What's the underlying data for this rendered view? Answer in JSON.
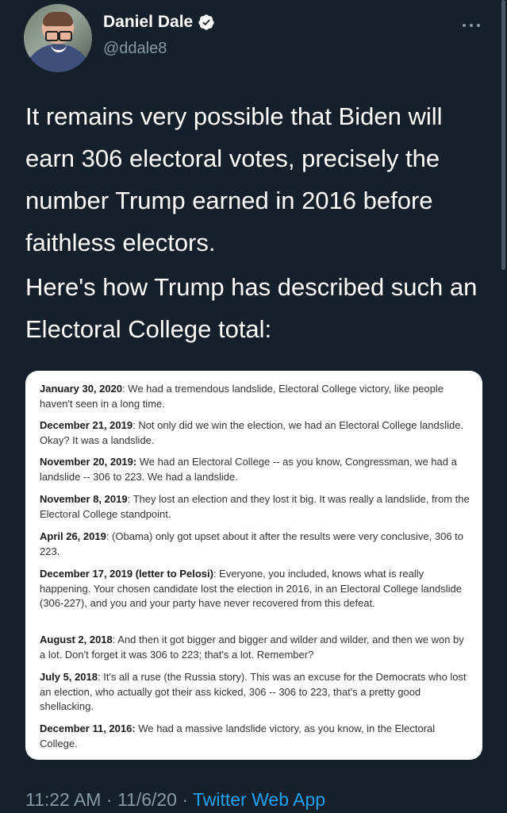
{
  "user": {
    "display_name": "Daniel Dale",
    "handle": "@ddale8",
    "verified": true
  },
  "tweet": {
    "paragraphs": [
      "It remains very possible that Biden will earn 306 electoral votes, precisely the number Trump earned in 2016 before faithless electors.",
      "Here's how Trump has described such an Electoral College total:"
    ],
    "image_entries": [
      {
        "date": "January 30, 2020",
        "text": ":  We had a tremendous landslide, Electoral College victory, like people haven't seen in a long time."
      },
      {
        "date": "December 21, 2019",
        "text": ": Not only did we win the election, we had an Electoral College landslide. Okay? It was a landslide."
      },
      {
        "date": "November 20, 2019:",
        "text": " We had an Electoral College -- as you know, Congressman, we had a landslide -- 306 to 223. We had a landslide."
      },
      {
        "date": "November 8, 2019",
        "text": ": They lost an election and they lost it big. It was really a landslide, from the Electoral College standpoint."
      },
      {
        "date": "April 26, 2019",
        "text": ": (Obama)  only got upset about it after the results were very conclusive, 306 to 223."
      },
      {
        "date": "December 17, 2019 (letter to Pelosi)",
        "text": ": Everyone, you included, knows what is really happening. Your chosen candidate lost the election in 2016, in an Electoral College landslide (306-227), and you and your party have never recovered from this defeat."
      },
      {
        "date": "August 2, 2018",
        "text": ": And then it got bigger and bigger and wilder and wilder, and then we won by a lot. Don't forget it was 306 to 223; that's a lot. Remember?"
      },
      {
        "date": "July 5, 2018",
        "text": ": It's all a ruse (the Russia story). This was an excuse for the Democrats who lost an election, who actually got their ass kicked, 306 -- 306 to 223, that's a pretty good shellacking."
      },
      {
        "date": "December 11, 2016:",
        "text": " We had a massive landslide victory, as you know, in the Electoral College."
      }
    ],
    "time": "11:22 AM",
    "separator": " · ",
    "date": "11/6/20",
    "app": "Twitter Web App"
  },
  "colors": {
    "background": "#15202b",
    "secondary_text": "#8899a6",
    "link": "#1da1f2",
    "verified_badge": "#ffffff"
  },
  "icons": [
    "avatar",
    "verified-badge-icon",
    "more-options-icon"
  ]
}
